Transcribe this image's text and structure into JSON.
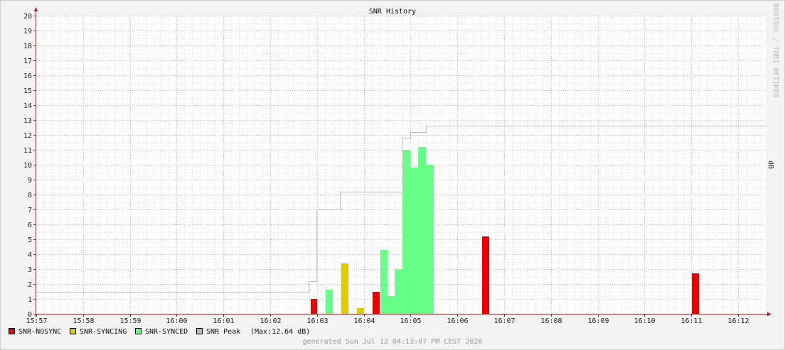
{
  "chart_data": {
    "type": "bar",
    "title": "SNR History",
    "ylabel": "dB",
    "watermark": "RRDTOOL / TOBI OETIKER",
    "footer": "generated Sun Jul 12 04:13:07 PM CEST 2026",
    "ylim": [
      0,
      20
    ],
    "y_ticks": [
      "0",
      "1",
      "2",
      "3",
      "4",
      "5",
      "6",
      "7",
      "8",
      "9",
      "10",
      "11",
      "12",
      "13",
      "14",
      "15",
      "16",
      "17",
      "18",
      "19",
      "20"
    ],
    "x_ticks": [
      "15:57",
      "15:58",
      "15:59",
      "16:00",
      "16:01",
      "16:02",
      "16:03",
      "16:04",
      "16:05",
      "16:06",
      "16:07",
      "16:08",
      "16:09",
      "16:10",
      "16:11",
      "16:12"
    ],
    "grid": true,
    "colors": {
      "nosync": "#ee0000",
      "syncing": "#ddcc00",
      "synced": "#66ff88",
      "peak": "#bbbbbb",
      "major_grid": "#e8a8a8",
      "minor_grid": "#dddddd",
      "axis": "#993333"
    },
    "series": [
      {
        "name": "SNR-NOSYNC",
        "bars": [
          {
            "x0": "16:02:52",
            "x1": "16:03:00",
            "y": 1.0
          },
          {
            "x0": "16:04:11",
            "x1": "16:04:20",
            "y": 1.5
          },
          {
            "x0": "16:06:32",
            "x1": "16:06:41",
            "y": 5.2
          },
          {
            "x0": "16:11:01",
            "x1": "16:11:10",
            "y": 2.7
          }
        ]
      },
      {
        "name": "SNR-SYNCING",
        "bars": [
          {
            "x0": "16:03:31",
            "x1": "16:03:40",
            "y": 3.4
          },
          {
            "x0": "16:03:51",
            "x1": "16:04:00",
            "y": 0.4
          }
        ]
      },
      {
        "name": "SNR-SYNCED",
        "bars": [
          {
            "x0": "16:03:11",
            "x1": "16:03:20",
            "y": 1.6
          },
          {
            "x0": "16:04:21",
            "x1": "16:04:30",
            "y": 4.3
          },
          {
            "x0": "16:04:30",
            "x1": "16:04:40",
            "y": 1.2
          },
          {
            "x0": "16:04:40",
            "x1": "16:04:50",
            "y": 3.0
          },
          {
            "x0": "16:04:50",
            "x1": "16:05:00",
            "y": 11.0
          },
          {
            "x0": "16:05:00",
            "x1": "16:05:10",
            "y": 9.8
          },
          {
            "x0": "16:05:10",
            "x1": "16:05:20",
            "y": 11.2
          },
          {
            "x0": "16:05:20",
            "x1": "16:05:30",
            "y": 10.0
          }
        ]
      },
      {
        "name": "SNR Peak",
        "legend_note": "(Max:12.64 dB)",
        "step": [
          {
            "x": "15:57:00",
            "y": 1.5
          },
          {
            "x": "16:02:50",
            "y": 2.2
          },
          {
            "x": "16:03:00",
            "y": 7.0
          },
          {
            "x": "16:03:30",
            "y": 8.2
          },
          {
            "x": "16:04:50",
            "y": 11.8
          },
          {
            "x": "16:05:00",
            "y": 12.2
          },
          {
            "x": "16:05:20",
            "y": 12.6
          },
          {
            "x": "16:12:30",
            "y": 12.6
          }
        ]
      }
    ]
  }
}
